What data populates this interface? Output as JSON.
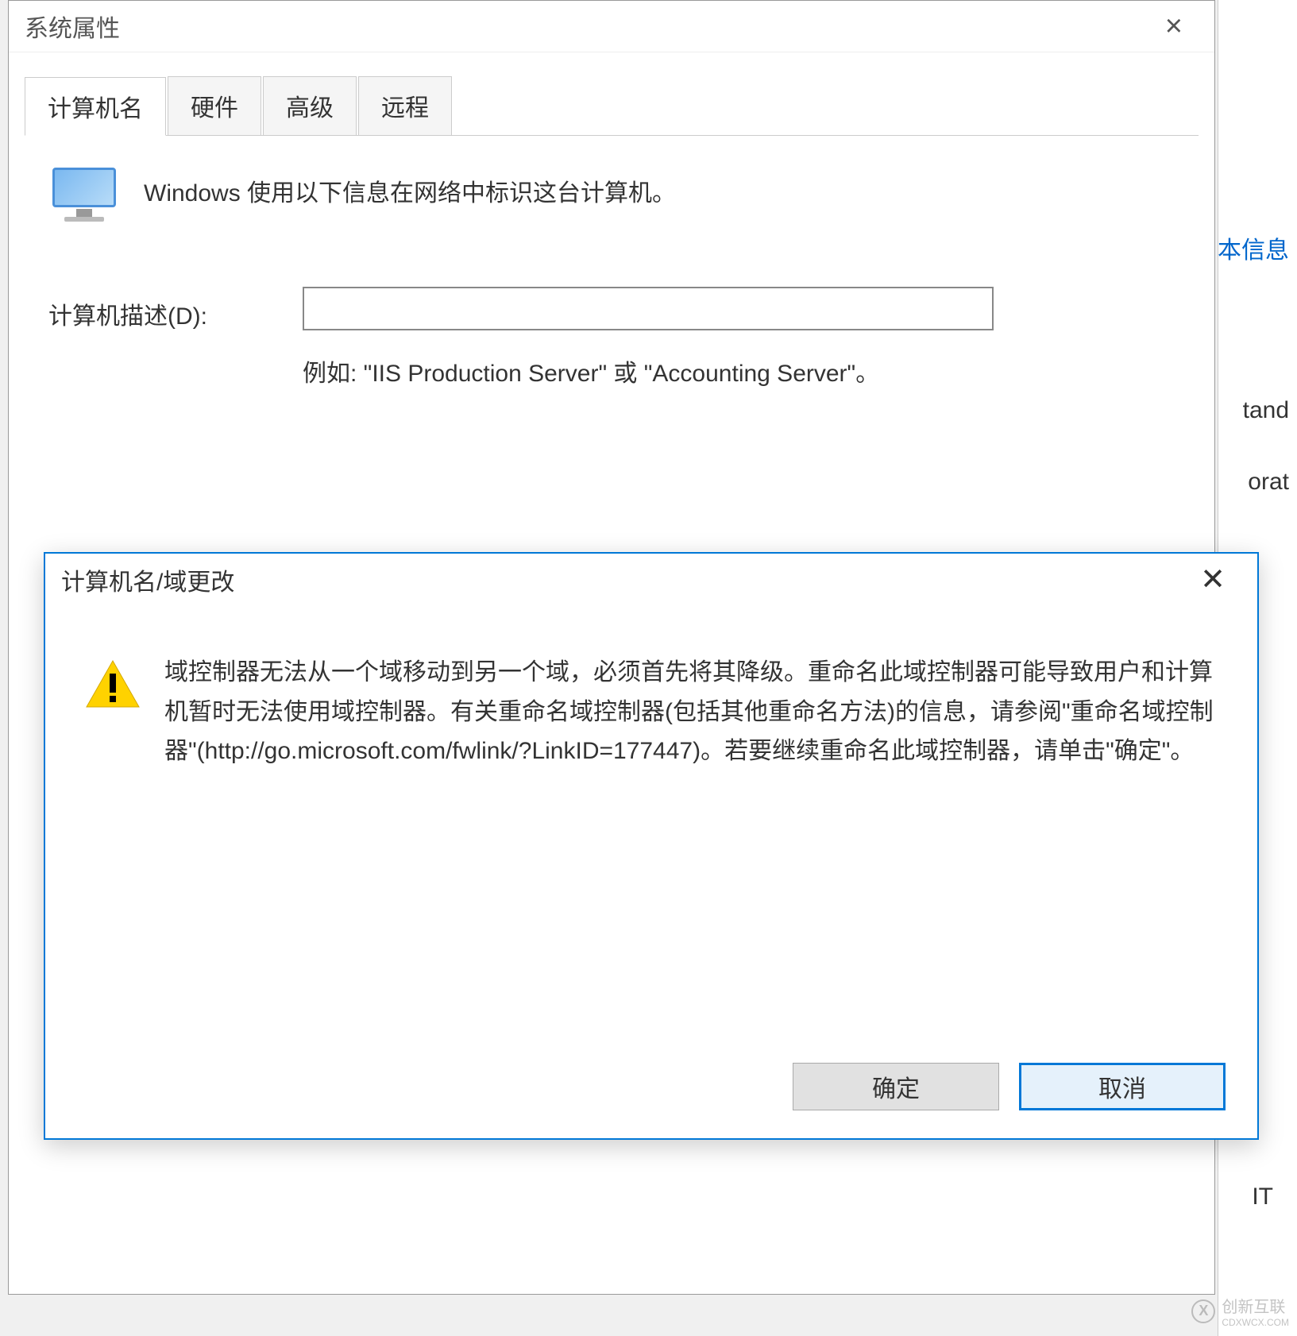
{
  "background": {
    "link": "本信息",
    "text1": "tand",
    "text2": "orat",
    "text3": "IT"
  },
  "window": {
    "title": "系统属性",
    "tabs": [
      "计算机名",
      "硬件",
      "高级",
      "远程"
    ],
    "activeTab": 0,
    "infoText": "Windows 使用以下信息在网络中标识这台计算机。",
    "descLabel": "计算机描述(D):",
    "descValue": "",
    "descHint": "例如: \"IIS Production Server\" 或 \"Accounting Server\"。"
  },
  "modal": {
    "title": "计算机名/域更改",
    "message": "域控制器无法从一个域移动到另一个域，必须首先将其降级。重命名此域控制器可能导致用户和计算机暂时无法使用域控制器。有关重命名域控制器(包括其他重命名方法)的信息，请参阅\"重命名域控制器\"(http://go.microsoft.com/fwlink/?LinkID=177447)。若要继续重命名此域控制器，请单击\"确定\"。",
    "okLabel": "确定",
    "cancelLabel": "取消"
  },
  "watermark": {
    "brand": "创新互联",
    "sub": "CDXWCX.COM"
  }
}
